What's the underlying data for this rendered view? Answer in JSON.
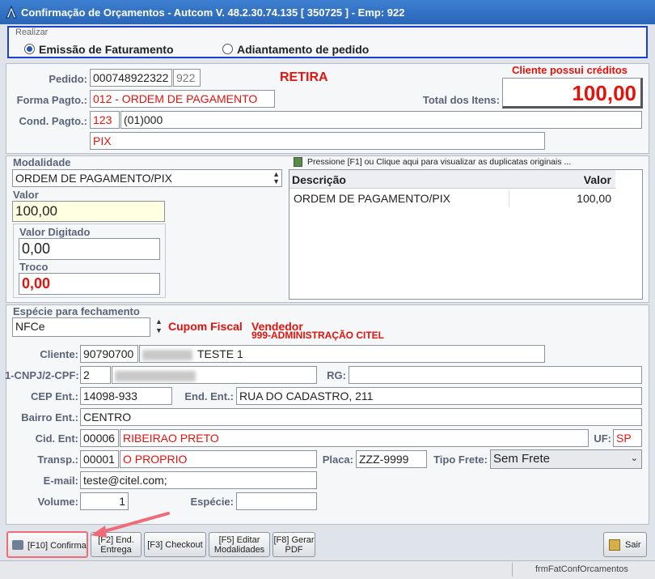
{
  "window": {
    "title": "Confirmação de Orçamentos  -  Autcom V. 48.2.30.74.135 [ 350725 ] - Emp: 922"
  },
  "realizar": {
    "legend": "Realizar",
    "option1": "Emissão de Faturamento",
    "option2": "Adiantamento de pedido",
    "selected": "option1"
  },
  "header": {
    "pedido_label": "Pedido:",
    "pedido_value": "000748922322",
    "pedido_emp": "922",
    "retira": "RETIRA",
    "forma_label": "Forma Pagto.:",
    "forma_value": "012 - ORDEM DE PAGAMENTO",
    "cond_label": "Cond. Pagto.:",
    "cond_code": "123",
    "cond_desc": "(01)000",
    "pix": "PIX",
    "cliente_creditos": "Cliente possui créditos",
    "total_label": "Total dos Itens:",
    "total_value": "100,00"
  },
  "modalidade": {
    "label": "Modalidade",
    "value": "ORDEM DE PAGAMENTO/PIX",
    "valor_label": "Valor",
    "valor_value": "100,00",
    "digitado_label": "Valor Digitado",
    "digitado_value": "0,00",
    "troco_label": "Troco",
    "troco_value": "0,00",
    "hint": "Pressione [F1] ou Clique aqui para visualizar as duplicatas originais ...",
    "grid_headers": [
      "Descrição",
      "Valor"
    ],
    "grid_rows": [
      {
        "descricao": "ORDEM DE PAGAMENTO/PIX",
        "valor": "100,00"
      }
    ]
  },
  "fechamento": {
    "especie_label": "Espécie para fechamento",
    "especie_value": "NFCe",
    "cupom": "Cupom Fiscal",
    "vendedor_label": "Vendedor",
    "vendedor_value": "999-ADMINISTRAÇÃO CITEL",
    "cliente_label": "Cliente:",
    "cliente_code": "90790700",
    "cliente_name": "TESTE 1",
    "cnpj_label": "1-CNPJ/2-CPF:",
    "cnpj_type": "2",
    "rg_label": "RG:",
    "cep_label": "CEP Ent.:",
    "cep_value": "14098-933",
    "end_label": "End. Ent.:",
    "end_value": "RUA DO CADASTRO, 211",
    "bairro_label": "Bairro Ent.:",
    "bairro_value": "CENTRO",
    "cid_label": "Cid. Ent:",
    "cid_code": "00006",
    "cid_name": "RIBEIRAO PRETO",
    "uf_label": "UF:",
    "uf_value": "SP",
    "transp_label": "Transp.:",
    "transp_code": "00001",
    "transp_name": "O PROPRIO",
    "placa_label": "Placa:",
    "placa_value": "ZZZ-9999",
    "frete_label": "Tipo Frete:",
    "frete_value": "Sem Frete",
    "email_label": "E-mail:",
    "email_value": "teste@citel.com;",
    "volume_label": "Volume:",
    "volume_value": "1",
    "especie2_label": "Espécie:",
    "especie2_value": ""
  },
  "buttons": {
    "confirma": "[F10] Confirma",
    "end1": "[F2] End.",
    "end2": "Entrega",
    "checkout": "[F3] Checkout",
    "editar1": "[F5] Editar",
    "editar2": "Modalidades",
    "pdf1": "[F8] Gerar",
    "pdf2": "PDF",
    "sair": "Sair"
  },
  "status": {
    "form_name": "frmFatConfOrcamentos"
  },
  "colors": {
    "accent_red": "#e3120b",
    "highlight": "#f06b78",
    "focus_blue": "#1b3fcf"
  }
}
